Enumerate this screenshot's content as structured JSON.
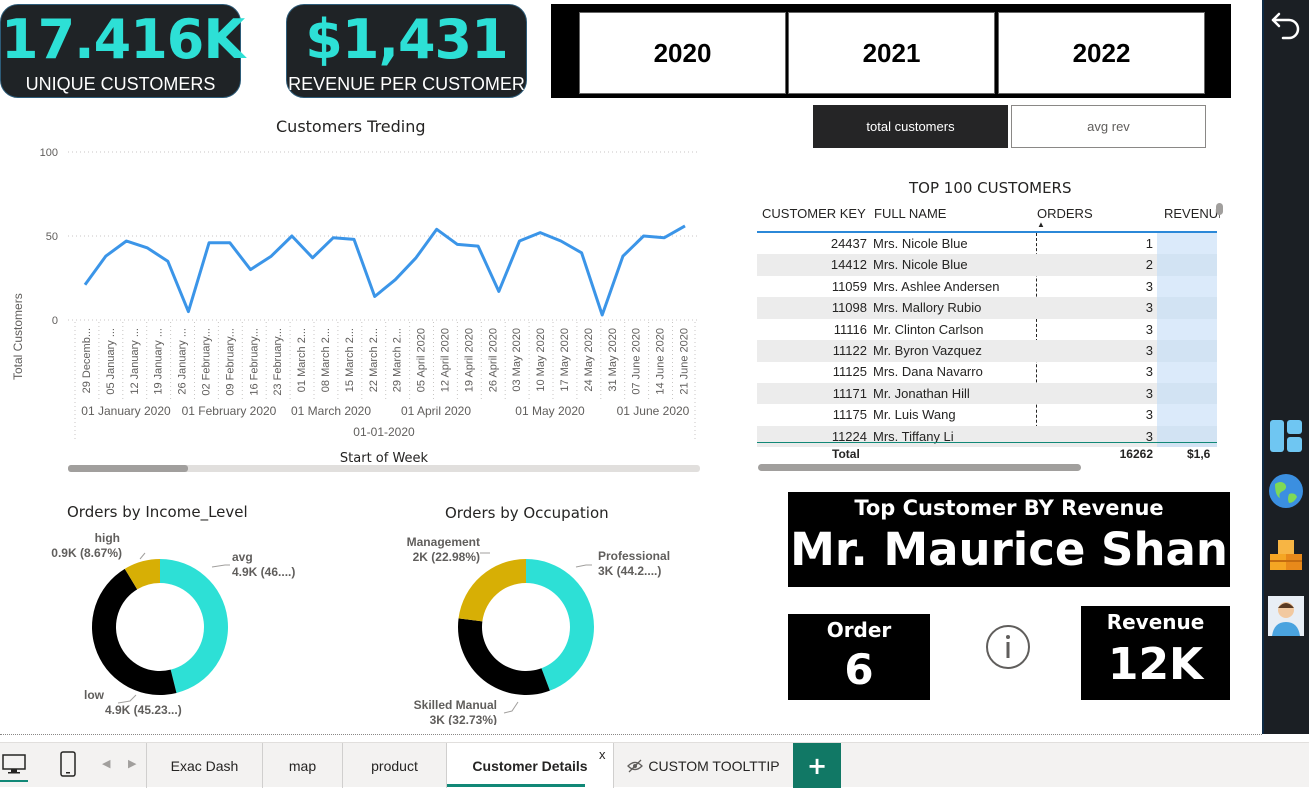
{
  "kpis": [
    {
      "value": "17.416K",
      "label": "UNIQUE CUSTOMERS"
    },
    {
      "value": "$1,431",
      "label": "REVENUE PER CUSTOMER"
    }
  ],
  "years": [
    "2020",
    "2021",
    "2022"
  ],
  "toggle": {
    "active": "total customers",
    "inactive": "avg rev"
  },
  "trend": {
    "title": "Customers Treding",
    "ylabel": "Total Customers",
    "xlabel": "Start of Week",
    "week_labels": [
      "29 Decemb...",
      "05 January ...",
      "12 January ...",
      "19 January ...",
      "26 January ...",
      "02 February...",
      "09 February...",
      "16 February...",
      "23 February...",
      "01 March 2...",
      "08 March 2...",
      "15 March 2...",
      "22 March 2...",
      "29 March 2...",
      "05 April 2020",
      "12 April 2020",
      "19 April 2020",
      "26 April 2020",
      "03 May 2020",
      "10 May 2020",
      "17 May 2020",
      "24 May 2020",
      "31 May 2020",
      "07 June 2020",
      "14 June 2020",
      "21 June 2020"
    ],
    "month_labels": [
      "01 January 2020",
      "01 February 2020",
      "01 March 2020",
      "01 April 2020",
      "01 May 2020",
      "01 June 2020"
    ],
    "year_label": "01-01-2020"
  },
  "chart_data": [
    {
      "type": "line",
      "title": "Customers Treding",
      "xlabel": "Start of Week",
      "ylabel": "Total Customers",
      "ylim": [
        0,
        100
      ],
      "yticks": [
        0,
        50,
        100
      ],
      "grid": true,
      "series": [
        {
          "values": [
            21,
            38,
            47,
            43,
            35,
            5,
            46,
            46,
            30,
            38,
            50,
            37,
            49,
            48,
            14,
            24,
            37,
            54,
            45,
            44,
            17,
            47,
            52,
            47,
            40,
            3,
            38,
            50,
            49,
            56
          ]
        }
      ],
      "color": "#3b95e8"
    },
    {
      "type": "pie",
      "title": "Orders by Income_Level",
      "labels": [
        "avg",
        "low",
        "high"
      ],
      "values": [
        46.1,
        45.23,
        8.67
      ],
      "display": [
        "4.9K (46....)",
        "4.9K (45.23...)",
        "0.9K (8.67%)"
      ],
      "colors": [
        "#2de0d6",
        "#000000",
        "#d7af05"
      ]
    },
    {
      "type": "pie",
      "title": "Orders by Occupation",
      "labels": [
        "Professional",
        "Skilled Manual",
        "Management"
      ],
      "values": [
        44.29,
        32.73,
        22.98
      ],
      "display": [
        "3K (44.2....)",
        "3K (32.73%)",
        "2K (22.98%)"
      ],
      "colors": [
        "#2de0d6",
        "#000000",
        "#d7af05"
      ]
    }
  ],
  "table": {
    "title": "TOP 100 CUSTOMERS",
    "headers": [
      "CUSTOMER KEY",
      "FULL NAME",
      "ORDERS",
      "REVENUI"
    ],
    "rows": [
      [
        "24437",
        "Mrs. Nicole Blue",
        "1"
      ],
      [
        "14412",
        "Mrs. Nicole Blue",
        "2"
      ],
      [
        "11059",
        "Mrs. Ashlee Andersen",
        "3"
      ],
      [
        "11098",
        "Mrs. Mallory Rubio",
        "3"
      ],
      [
        "11116",
        "Mr. Clinton Carlson",
        "3"
      ],
      [
        "11122",
        "Mr. Byron Vazquez",
        "3"
      ],
      [
        "11125",
        "Mrs. Dana Navarro",
        "3"
      ],
      [
        "11171",
        "Mr. Jonathan Hill",
        "3"
      ],
      [
        "11175",
        "Mr. Luis Wang",
        "3"
      ],
      [
        "11224",
        "Mrs. Tiffany Li",
        "3"
      ]
    ],
    "total_label": "Total",
    "total_orders": "16262",
    "total_revenue": "$1,6"
  },
  "top_customer": {
    "title": "Top Customer BY Revenue",
    "name": "Mr. Maurice Shan"
  },
  "order_card": {
    "label": "Order",
    "value": "6"
  },
  "revenue_card": {
    "label": "Revenue",
    "value": "12K"
  },
  "tabs": [
    "Exac Dash",
    "map",
    "product",
    "Customer Details",
    "CUSTOM TOOLTTIP"
  ],
  "active_tab": "Customer Details",
  "tab_close": "x",
  "add_tab": "+"
}
